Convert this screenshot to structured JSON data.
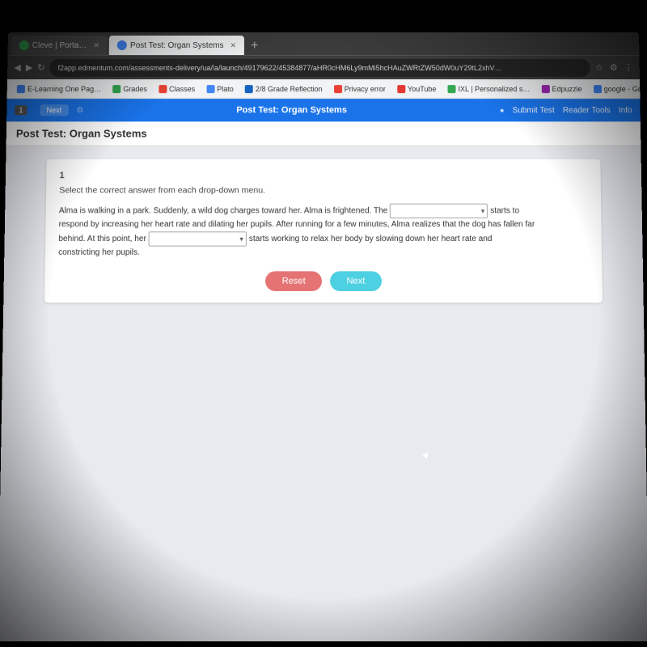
{
  "browser": {
    "tabs": [
      {
        "id": "tab-cleveportal",
        "label": "Cleve | Porta…",
        "active": false,
        "favicon": "green"
      },
      {
        "id": "tab-posttest",
        "label": "Post Test: Organ Systems",
        "active": true,
        "favicon": "blue"
      }
    ],
    "url": "f2app.edmentum.com/assessments-delivery/ua/la/launch/49179622/45384877/aHR0cHM6Ly9mMi5hcHAuZWRtZW50dW0uY29tL2xhV…",
    "bookmarks": [
      {
        "label": "E-Learning One Pag…",
        "type": "blue"
      },
      {
        "label": "Grades",
        "type": "green"
      },
      {
        "label": "Classes",
        "type": "orange"
      },
      {
        "label": "Plato",
        "type": "blue"
      },
      {
        "label": "2/8 Grade Reflection",
        "type": "blue2"
      },
      {
        "label": "Privacy error",
        "type": "orange"
      },
      {
        "label": "YouTube",
        "type": "red"
      },
      {
        "label": "IXL | Personalized s…",
        "type": "green"
      },
      {
        "label": "Edpuzzle",
        "type": "purple"
      },
      {
        "label": "google - Google Se…",
        "type": "blue"
      }
    ]
  },
  "app_nav": {
    "prev_label": "1",
    "next_label": "Next",
    "title": "Post Test: Organ Systems",
    "submit_label": "Submit Test",
    "reader_label": "Reader Tools",
    "info_label": "Info"
  },
  "question": {
    "number": "1",
    "instruction": "Select the correct answer from each drop-down menu.",
    "passage": "Alma is walking in a park. Suddenly, a wild dog charges toward her. Alma is frightened. The",
    "passage2": "respond by increasing her heart rate and dilating her pupils. After running for a few minutes, Alma realizes that the dog has fallen far",
    "passage3": "behind. At this point, her",
    "passage4": "starts working to relax her body by slowing down her heart rate and",
    "passage5": "constricting her pupils.",
    "dropdown1_placeholder": "",
    "dropdown2_placeholder": "",
    "starts_to_label": "starts to",
    "reset_label": "Reset",
    "next_label": "Next"
  }
}
